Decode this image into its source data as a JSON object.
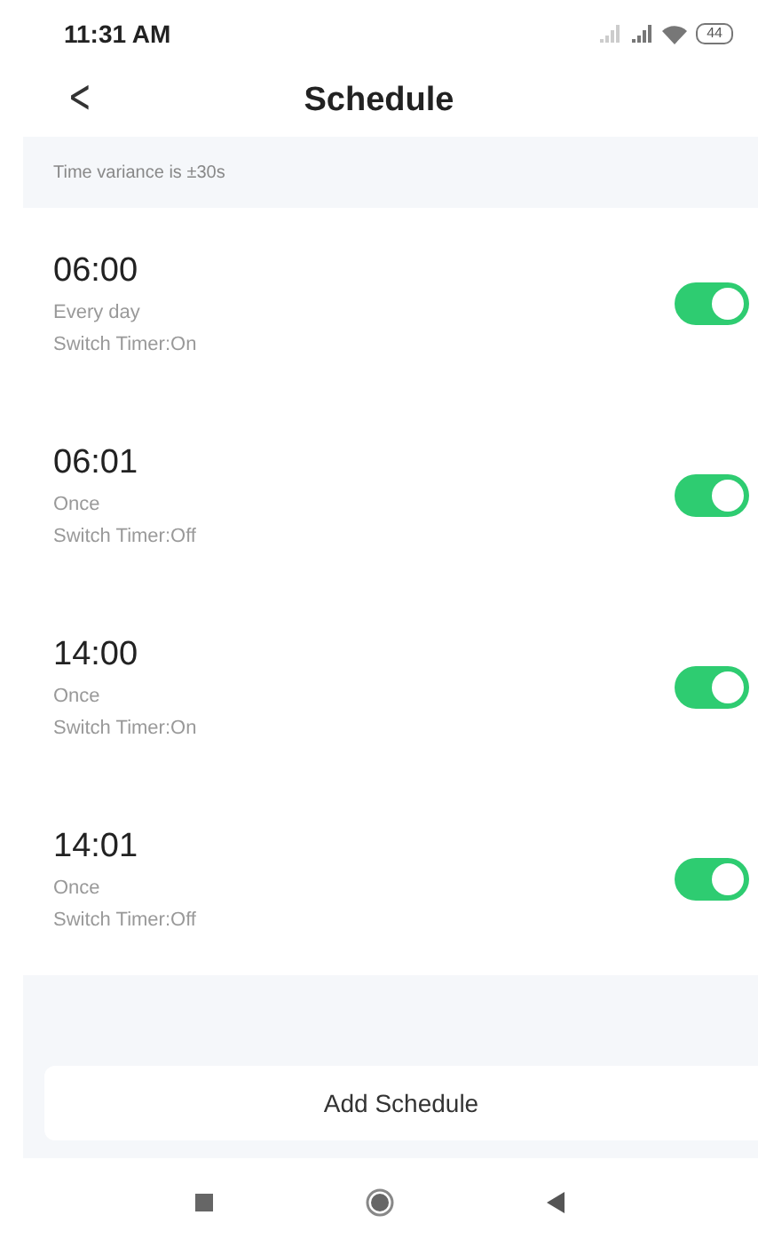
{
  "status_bar": {
    "time": "11:31 AM",
    "battery": "44"
  },
  "header": {
    "back": "<",
    "title": "Schedule"
  },
  "notice": "Time variance is ±30s",
  "schedules": [
    {
      "time": "06:00",
      "repeat": "Every day",
      "action": "Switch Timer:On",
      "on": true
    },
    {
      "time": "06:01",
      "repeat": "Once",
      "action": "Switch Timer:Off",
      "on": true
    },
    {
      "time": "14:00",
      "repeat": "Once",
      "action": "Switch Timer:On",
      "on": true
    },
    {
      "time": "14:01",
      "repeat": "Once",
      "action": "Switch Timer:Off",
      "on": true
    }
  ],
  "add_button": "Add Schedule"
}
